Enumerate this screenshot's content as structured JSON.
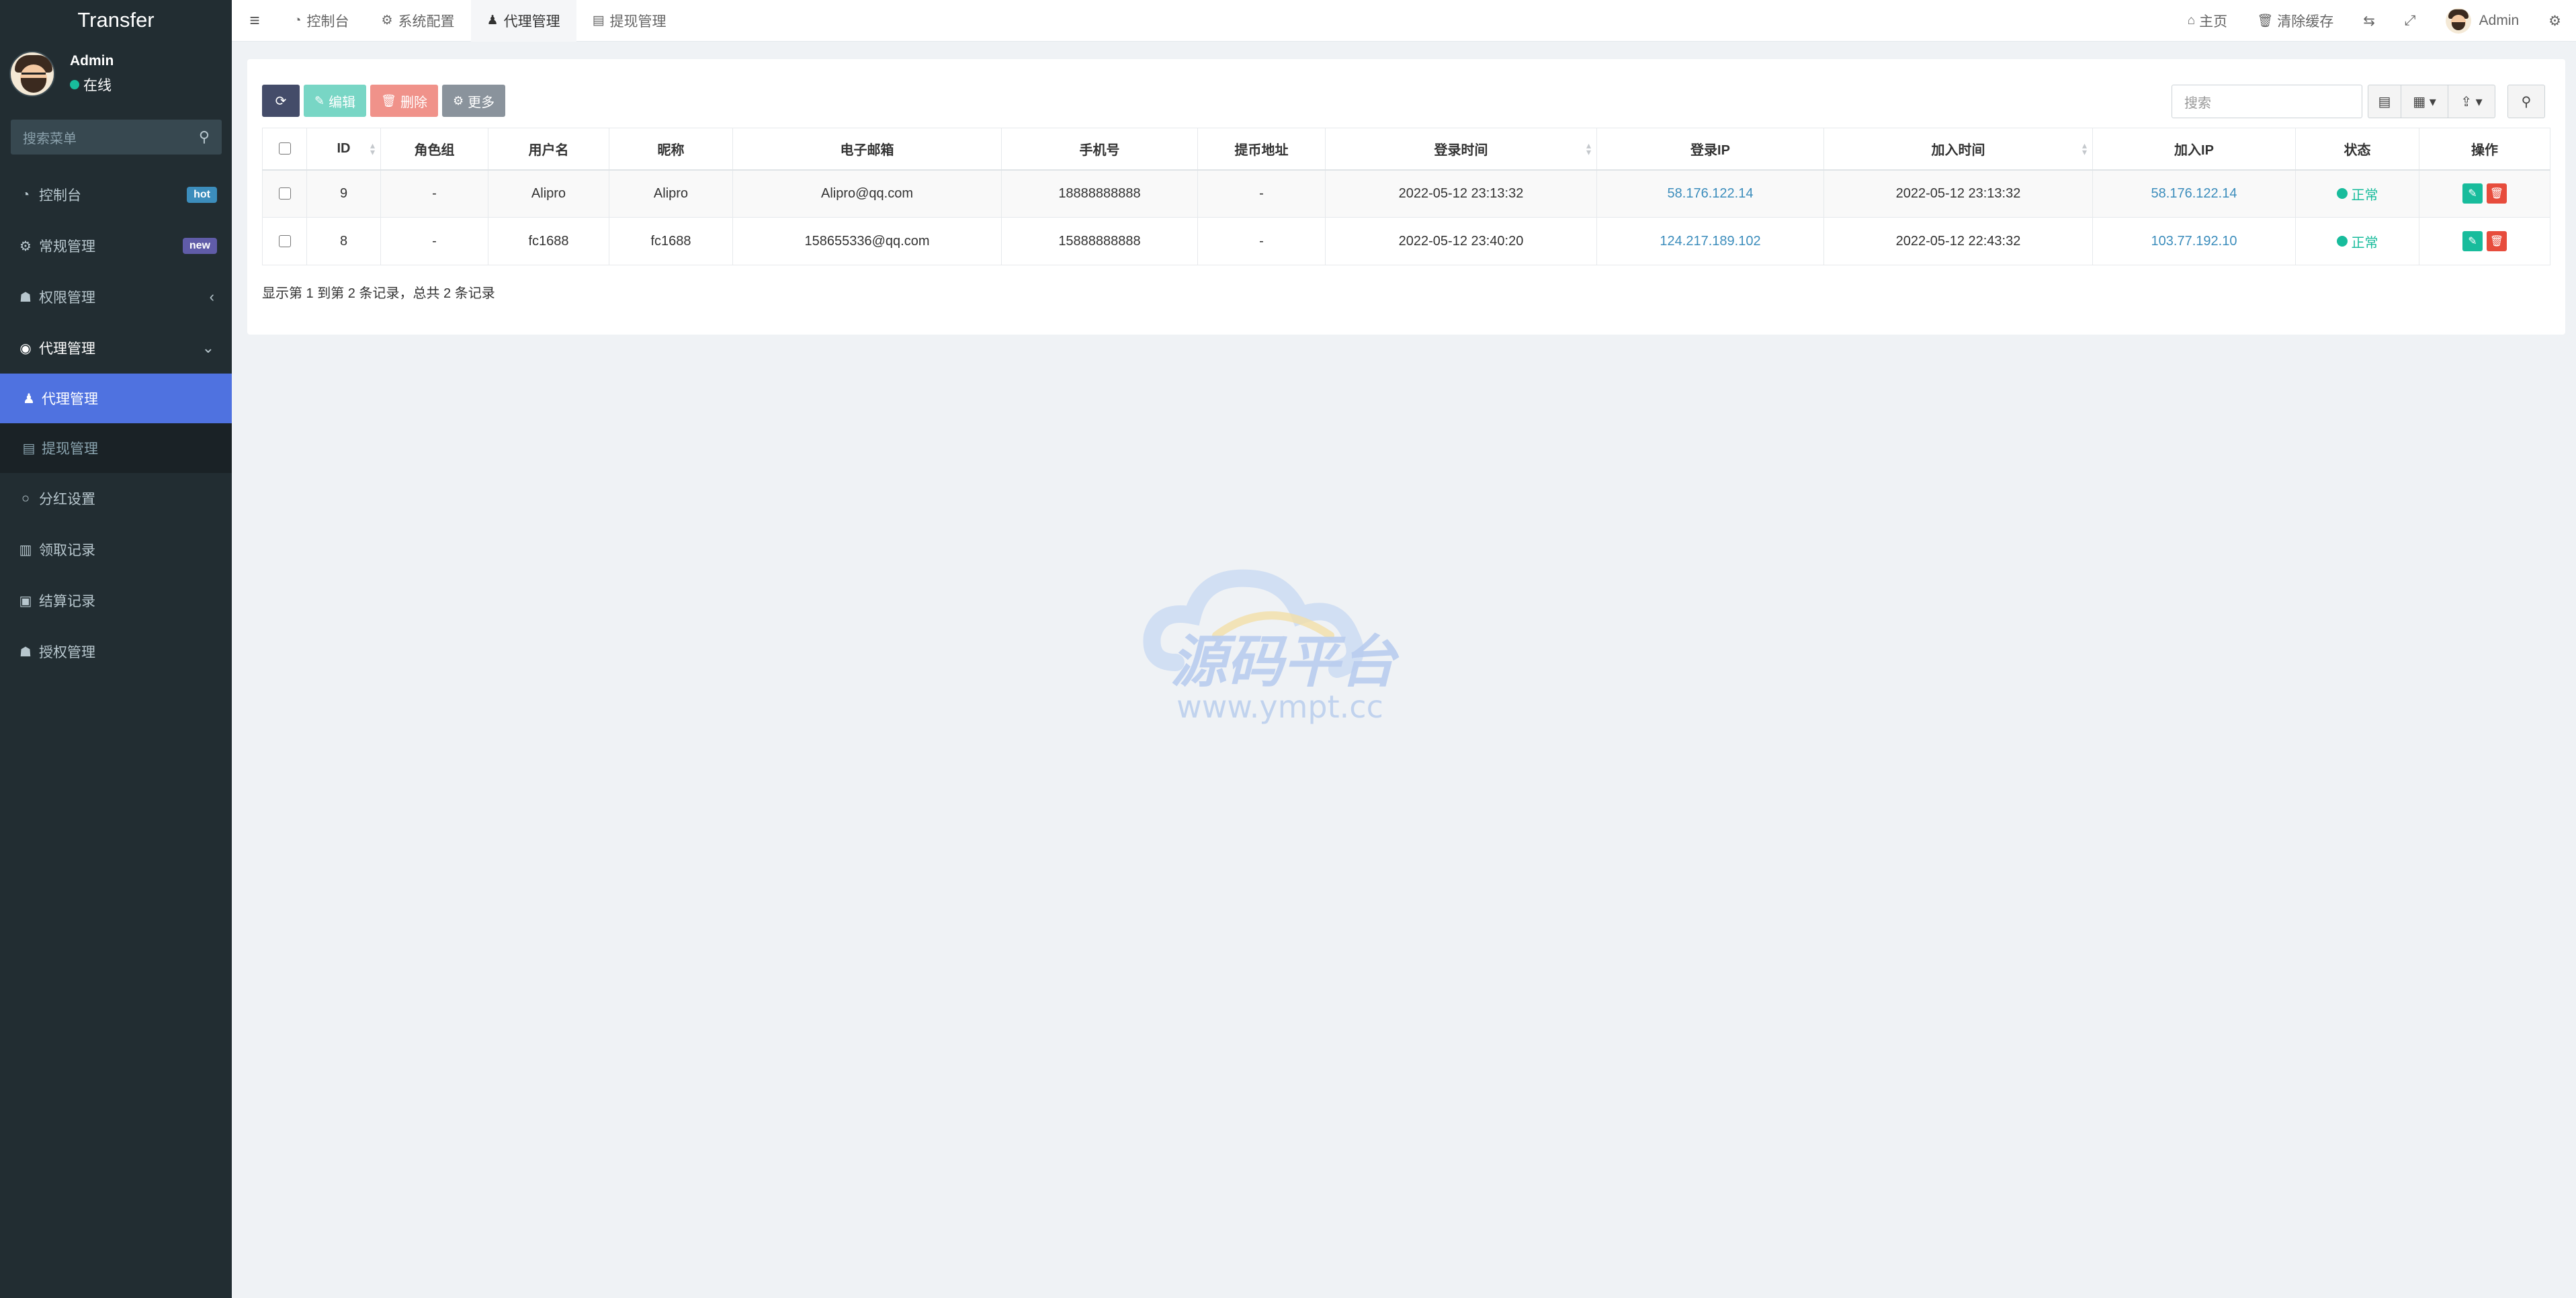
{
  "app": {
    "title": "Transfer"
  },
  "user": {
    "name": "Admin",
    "status": "在线"
  },
  "sidebar": {
    "search_placeholder": "搜索菜单",
    "items": [
      {
        "label": "控制台",
        "badge": "hot"
      },
      {
        "label": "常规管理",
        "badge": "new"
      },
      {
        "label": "权限管理"
      },
      {
        "label": "代理管理"
      },
      {
        "label": "代理管理"
      },
      {
        "label": "提现管理"
      },
      {
        "label": "分红设置"
      },
      {
        "label": "领取记录"
      },
      {
        "label": "结算记录"
      },
      {
        "label": "授权管理"
      }
    ]
  },
  "topbar": {
    "tabs": [
      {
        "label": "控制台"
      },
      {
        "label": "系统配置"
      },
      {
        "label": "代理管理"
      },
      {
        "label": "提现管理"
      }
    ],
    "home": "主页",
    "clear_cache": "清除缓存",
    "user": "Admin"
  },
  "toolbar": {
    "edit": "编辑",
    "delete": "删除",
    "more": "更多",
    "search_placeholder": "搜索"
  },
  "table": {
    "headers": [
      "ID",
      "角色组",
      "用户名",
      "昵称",
      "电子邮箱",
      "手机号",
      "提币地址",
      "登录时间",
      "登录IP",
      "加入时间",
      "加入IP",
      "状态",
      "操作"
    ],
    "rows": [
      {
        "id": "9",
        "group": "-",
        "username": "Alipro",
        "nickname": "Alipro",
        "email": "Alipro@qq.com",
        "mobile": "18888888888",
        "address": "-",
        "login_time": "2022-05-12 23:13:32",
        "login_ip": "58.176.122.14",
        "join_time": "2022-05-12 23:13:32",
        "join_ip": "58.176.122.14",
        "status": "正常"
      },
      {
        "id": "8",
        "group": "-",
        "username": "fc1688",
        "nickname": "fc1688",
        "email": "158655336@qq.com",
        "mobile": "15888888888",
        "address": "-",
        "login_time": "2022-05-12 23:40:20",
        "login_ip": "124.217.189.102",
        "join_time": "2022-05-12 22:43:32",
        "join_ip": "103.77.192.10",
        "status": "正常"
      }
    ]
  },
  "pagination": {
    "summary": "显示第 1 到第 2 条记录，总共 2 条记录"
  },
  "watermark": {
    "name": "源码平台",
    "url": "www.ympt.cc"
  },
  "colors": {
    "sidebar": "#222d32",
    "active": "#4f72e0",
    "success": "#18bc9c",
    "danger": "#e74c3c",
    "link": "#3c8dbc"
  }
}
